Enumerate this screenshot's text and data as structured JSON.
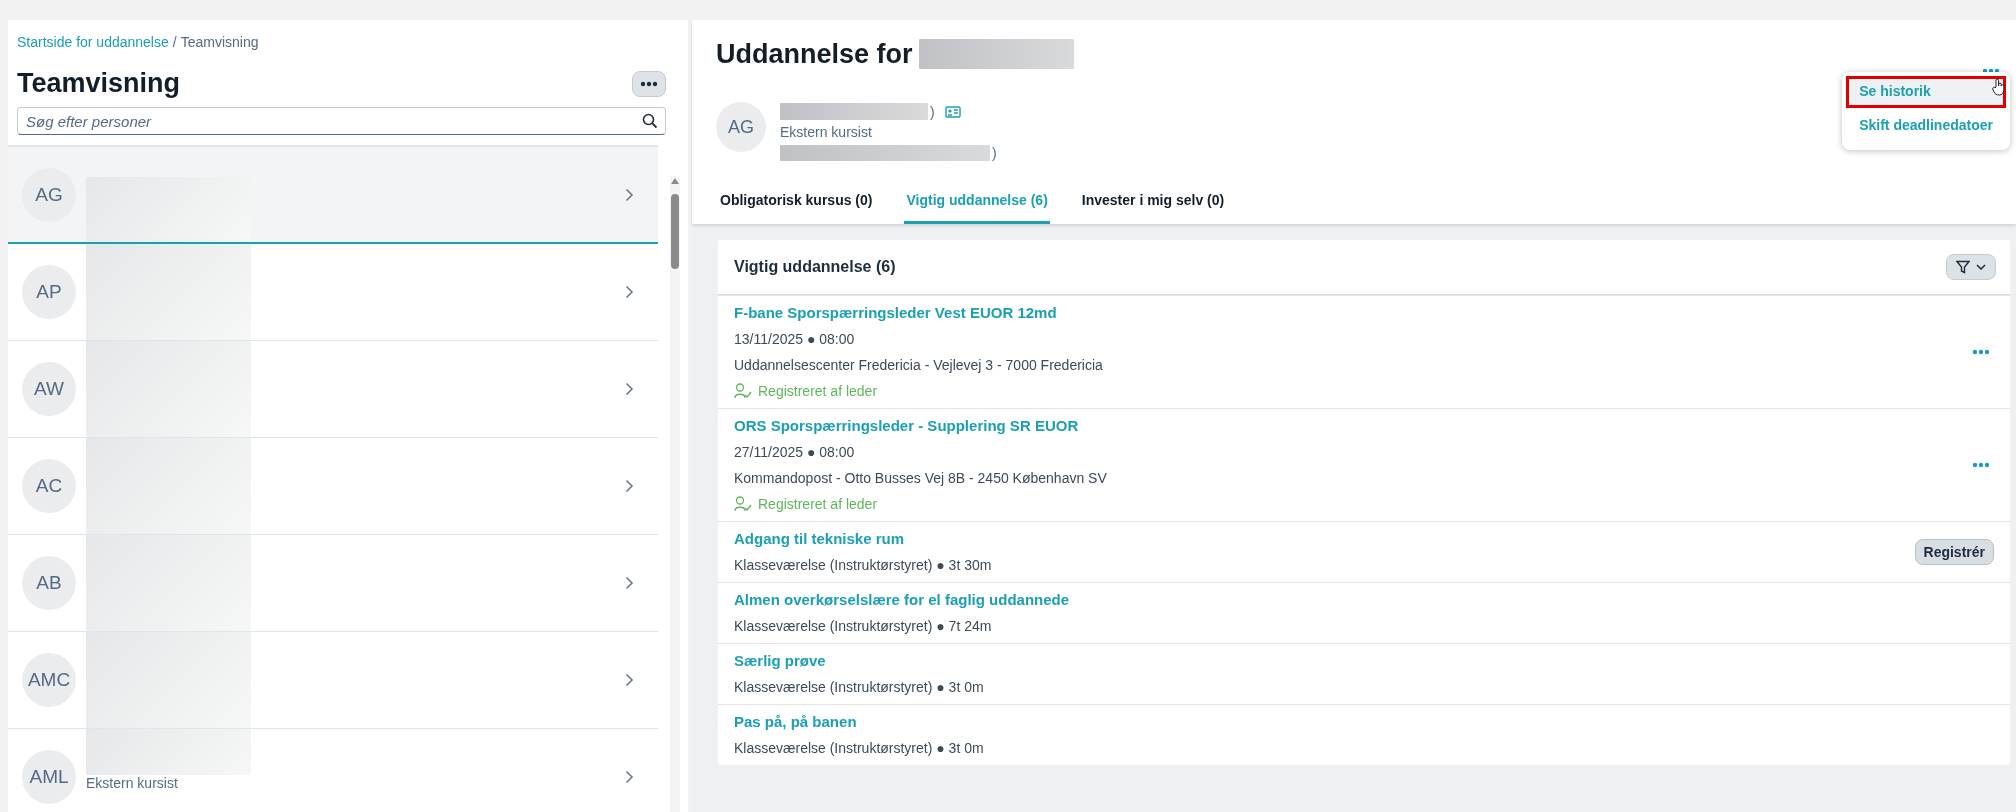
{
  "breadcrumb": {
    "link": "Startside for uddannelse",
    "separator": "/",
    "current": "Teamvisning"
  },
  "left_title": "Teamvisning",
  "search": {
    "placeholder": "Søg efter personer"
  },
  "people": [
    {
      "initials": "AG",
      "selected": true
    },
    {
      "initials": "AP",
      "selected": false
    },
    {
      "initials": "AW",
      "selected": false
    },
    {
      "initials": "AC",
      "selected": false
    },
    {
      "initials": "AB",
      "selected": false
    },
    {
      "initials": "AMC",
      "selected": false
    },
    {
      "initials": "AML",
      "selected": false,
      "subtitle": "Ekstern kursist"
    }
  ],
  "detail": {
    "title": "Uddannelse for",
    "initials": "AG",
    "name_suffix": ")",
    "role": "Ekstern kursist",
    "email_suffix": ")"
  },
  "menu": {
    "items": [
      {
        "label": "Se historik",
        "highlighted": true
      },
      {
        "label": "Skift deadlinedatoer",
        "highlighted": false
      }
    ]
  },
  "tabs": [
    {
      "label": "Obligatorisk kursus (0)",
      "selected": false
    },
    {
      "label": "Vigtig uddannelse (6)",
      "selected": true
    },
    {
      "label": "Invester i mig selv (0)",
      "selected": false
    }
  ],
  "section": {
    "title": "Vigtig uddannelse (6)",
    "courses": [
      {
        "kind": "session",
        "title": "F-bane Sporspærringsleder Vest EUOR 12md",
        "date": "13/11/2025 ● 08:00",
        "location": "Uddannelsescenter Fredericia - Vejlevej 3 - 7000 Fredericia",
        "status": "Registreret af leder"
      },
      {
        "kind": "session",
        "title": "ORS Sporspærringsleder - Supplering SR EUOR",
        "date": "27/11/2025 ● 08:00",
        "location": "Kommandopost - Otto Busses Vej 8B - 2450 København SV",
        "status": "Registreret af leder"
      },
      {
        "kind": "module",
        "title": "Adgang til tekniske rum",
        "info": "Klasseværelse (Instruktørstyret) ● 3t 30m",
        "action": "Registrér"
      },
      {
        "kind": "module",
        "title": "Almen overkørselslære for el faglig uddannede",
        "info": "Klasseværelse (Instruktørstyret) ● 7t 24m"
      },
      {
        "kind": "module",
        "title": "Særlig prøve",
        "info": "Klasseværelse (Instruktørstyret) ● 3t 0m"
      },
      {
        "kind": "module",
        "title": "Pas på, på banen",
        "info": "Klasseværelse (Instruktørstyret) ● 3t 0m"
      }
    ]
  }
}
